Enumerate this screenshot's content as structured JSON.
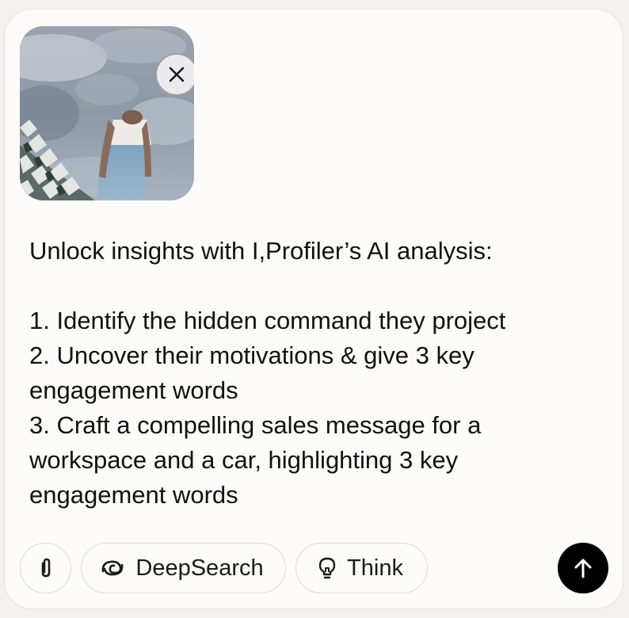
{
  "composer": {
    "attachment": {
      "kind": "image-thumbnail",
      "remove_icon": "close-icon"
    },
    "prompt_lines": [
      "Unlock insights with I,Profiler’s AI analysis:",
      "",
      "1. Identify the hidden command they project",
      "2. Uncover their motivations & give 3 key engagement words",
      "3. Craft a compelling sales message for a workspace and a car, highlighting 3 key engagement words"
    ]
  },
  "toolbar": {
    "attach_icon": "paperclip-icon",
    "deepsearch": {
      "icon": "deepsearch-swirl-icon",
      "label": "DeepSearch"
    },
    "think": {
      "icon": "lightbulb-icon",
      "label": "Think"
    },
    "send_icon": "arrow-up-icon"
  },
  "colors": {
    "page_background": "#f2f1ef",
    "composer_background": "#fcfbf9",
    "border": "#dcdad6",
    "text": "#111111",
    "send_button": "#000000"
  }
}
